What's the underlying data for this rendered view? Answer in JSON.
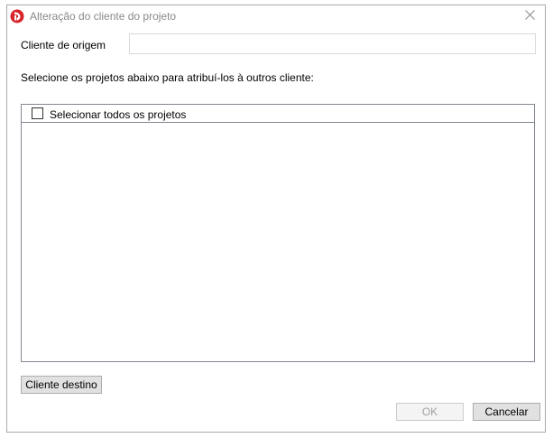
{
  "window": {
    "title": "Alteração do cliente do projeto"
  },
  "form": {
    "origin_label": "Cliente de origem",
    "origin_value": "",
    "instructions": "Selecione os projetos abaixo para atribuí-los à outros cliente:"
  },
  "project_list": {
    "select_all_label": "Selecionar todos os projetos",
    "select_all_checked": false,
    "items": []
  },
  "buttons": {
    "destination_label": "Cliente destino",
    "ok_label": "OK",
    "ok_enabled": false,
    "cancel_label": "Cancelar"
  },
  "colors": {
    "app_icon_red": "#d9232a",
    "title_text": "#888888",
    "disabled_text": "#a0a0a0"
  },
  "icons": {
    "app": "app-logo-icon",
    "close": "close-icon"
  }
}
